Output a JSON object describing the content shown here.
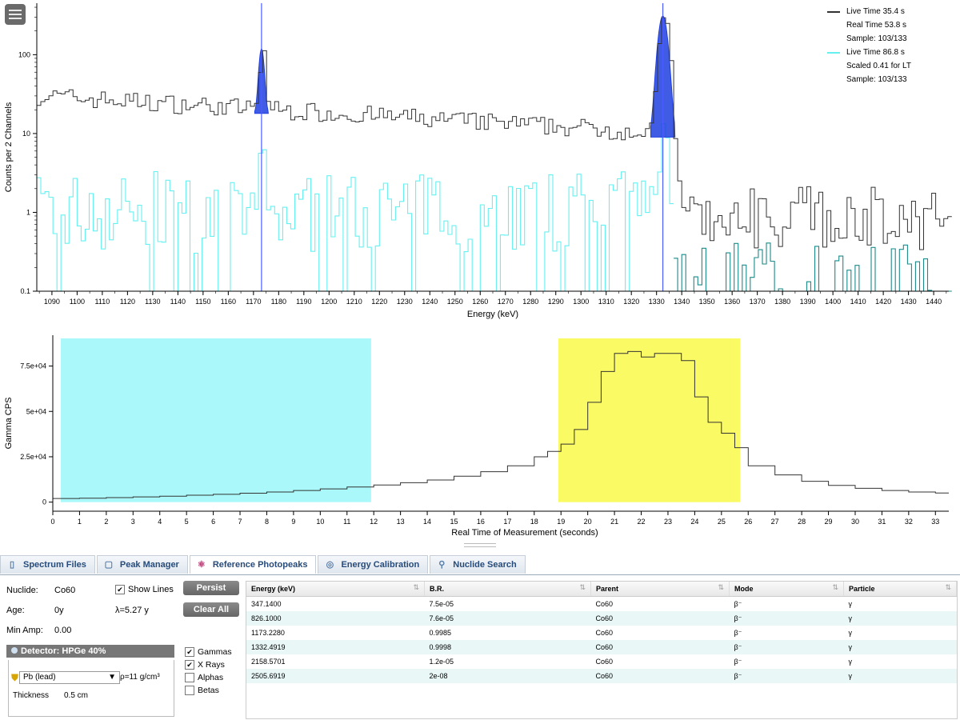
{
  "legend": {
    "entries": [
      {
        "name": "Live Time 35.4 s",
        "color": "#333333",
        "lines": [
          "Real Time 53.8 s",
          "Sample: 103/133"
        ]
      },
      {
        "name": "Live Time 86.8 s",
        "color": "#66f0f0",
        "lines": [
          "Scaled 0.41 for LT",
          "Sample: 103/133"
        ]
      }
    ]
  },
  "chart_data": [
    {
      "type": "line",
      "xlabel": "Energy (keV)",
      "ylabel": "Counts per 2 Channels",
      "yscale": "log",
      "xlim": [
        1084,
        1446
      ],
      "ylim": [
        0.1,
        450
      ],
      "yticks": [
        0.1,
        1,
        10,
        100
      ],
      "ytick_labels": [
        "0.1",
        "1",
        "10",
        "100"
      ],
      "xticks": [
        1090,
        1100,
        1110,
        1120,
        1130,
        1140,
        1150,
        1160,
        1170,
        1180,
        1190,
        1200,
        1210,
        1220,
        1230,
        1240,
        1250,
        1260,
        1270,
        1280,
        1290,
        1300,
        1310,
        1320,
        1330,
        1340,
        1350,
        1360,
        1370,
        1380,
        1390,
        1400,
        1410,
        1420,
        1430,
        1440
      ],
      "reference_lines_keV": [
        1173.2,
        1332.5
      ],
      "peaks": [
        {
          "center_keV": 1173.2,
          "height": 100,
          "background": 18,
          "color": "#1f3fe0"
        },
        {
          "center_keV": 1332.5,
          "height": 300,
          "background": 9,
          "color": "#1f3fe0"
        }
      ],
      "series": [
        {
          "name": "Live Time 35.4 s",
          "color": "#333333",
          "approx_level_start": 30,
          "approx_level_end": 10,
          "edge_keV": 1336,
          "above_edge_level": 1
        },
        {
          "name": "Live Time 86.8 s",
          "color": "#66f0f0",
          "approx_level": 1,
          "edge_keV": 1336,
          "above_edge_color": "#1a8a8a"
        }
      ]
    },
    {
      "type": "line",
      "xlabel": "Real Time of Measurement (seconds)",
      "ylabel": "Gamma CPS",
      "xlim": [
        0,
        33.5
      ],
      "ylim": [
        -5000,
        92000
      ],
      "yticks": [
        0,
        25000,
        50000,
        75000
      ],
      "ytick_labels": [
        "0",
        "2.5e+04",
        "5e+04",
        "7.5e+04"
      ],
      "xticks": [
        0,
        1,
        2,
        3,
        4,
        5,
        6,
        7,
        8,
        9,
        10,
        11,
        12,
        13,
        14,
        15,
        16,
        17,
        18,
        19,
        20,
        21,
        22,
        23,
        24,
        25,
        26,
        27,
        28,
        29,
        30,
        31,
        32,
        33
      ],
      "highlight_regions": [
        {
          "from": 0.3,
          "to": 11.9,
          "color": "#aaf8fa"
        },
        {
          "from": 18.9,
          "to": 25.7,
          "color": "#fafa64"
        }
      ],
      "x": [
        0,
        1,
        2,
        3,
        4,
        5,
        6,
        7,
        8,
        9,
        10,
        11,
        12,
        13,
        14,
        15,
        16,
        17,
        18,
        18.5,
        19,
        19.5,
        20,
        20.5,
        21,
        21.5,
        22,
        22.5,
        23,
        23.5,
        24,
        24.5,
        25,
        25.5,
        26,
        27,
        28,
        29,
        30,
        31,
        32,
        33
      ],
      "y": [
        2000,
        2200,
        2500,
        2900,
        3300,
        3800,
        4300,
        4900,
        5600,
        6400,
        7300,
        8300,
        9400,
        10700,
        12200,
        14300,
        16800,
        20000,
        25000,
        28000,
        32000,
        40000,
        55000,
        72000,
        82000,
        83000,
        80000,
        82000,
        82000,
        78000,
        58000,
        44000,
        38000,
        30000,
        20000,
        15000,
        11500,
        9200,
        7600,
        6400,
        5600,
        5000
      ],
      "series": [
        {
          "color": "#333333"
        }
      ]
    }
  ],
  "tabs": [
    {
      "label": "Spectrum Files",
      "icon": "file-icon"
    },
    {
      "label": "Peak Manager",
      "icon": "window-icon"
    },
    {
      "label": "Reference Photopeaks",
      "icon": "atom-icon"
    },
    {
      "label": "Energy Calibration",
      "icon": "calibration-icon"
    },
    {
      "label": "Nuclide Search",
      "icon": "search-icon"
    }
  ],
  "panel": {
    "nuclide_label": "Nuclide:",
    "nuclide_value": "Co60",
    "show_lines_label": "Show Lines",
    "persist_label": "Persist",
    "age_label": "Age:",
    "age_value": "0y",
    "halflife_text": "λ=5.27 y",
    "clear_all_label": "Clear All",
    "min_amp_label": "Min Amp:",
    "min_amp_value": "0.00",
    "detector_label": "Detector: HPGe 40%",
    "material_value": "Pb (lead)",
    "density_text": "ρ=11 g/cm³",
    "thickness_label": "Thickness",
    "thickness_value": "0.5 cm",
    "particles": [
      {
        "label": "Gammas",
        "checked": true
      },
      {
        "label": "X Rays",
        "checked": true
      },
      {
        "label": "Alphas",
        "checked": false
      },
      {
        "label": "Betas",
        "checked": false
      }
    ]
  },
  "table": {
    "columns": [
      "Energy (keV)",
      "B.R.",
      "Parent",
      "Mode",
      "Particle"
    ],
    "rows": [
      [
        "347.1400",
        "7.5e-05",
        "Co60",
        "β⁻",
        "γ"
      ],
      [
        "826.1000",
        "7.6e-05",
        "Co60",
        "β⁻",
        "γ"
      ],
      [
        "1173.2280",
        "0.9985",
        "Co60",
        "β⁻",
        "γ"
      ],
      [
        "1332.4919",
        "0.9998",
        "Co60",
        "β⁻",
        "γ"
      ],
      [
        "2158.5701",
        "1.2e-05",
        "Co60",
        "β⁻",
        "γ"
      ],
      [
        "2505.6919",
        "2e-08",
        "Co60",
        "β⁻",
        "γ"
      ]
    ]
  }
}
